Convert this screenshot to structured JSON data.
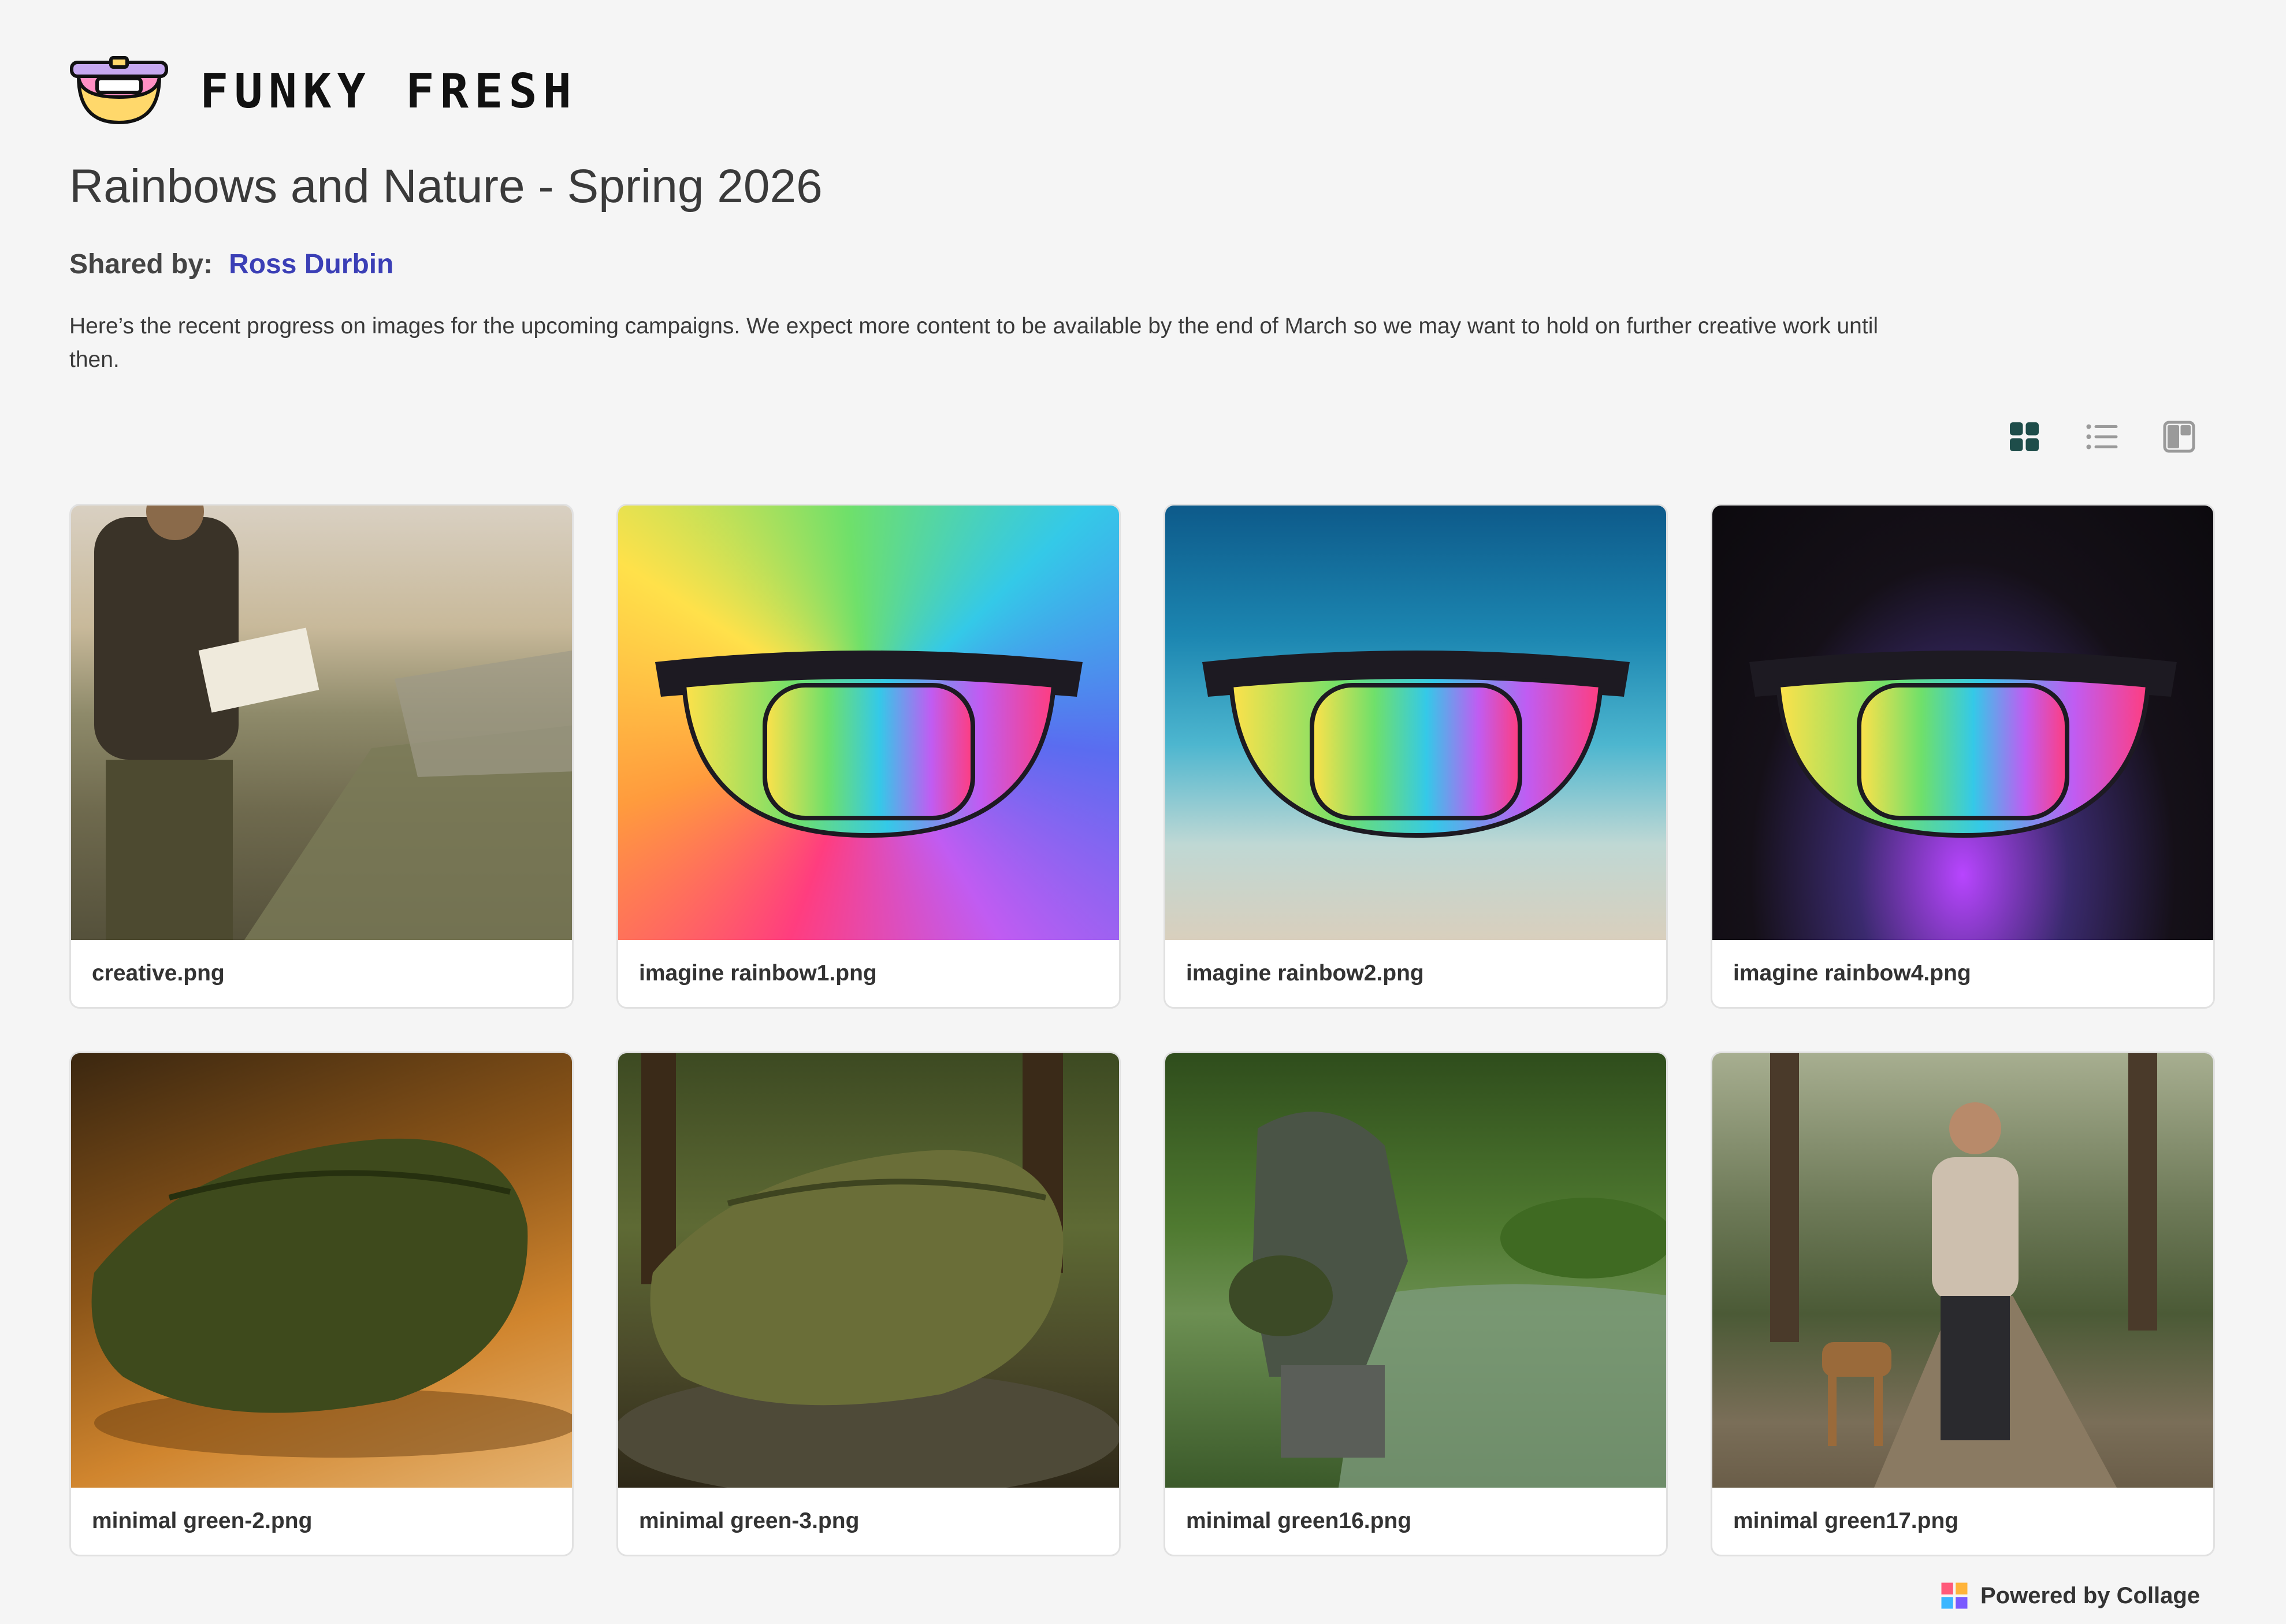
{
  "brand": {
    "name": "FUNKY FRESH",
    "logo_icon": "fanny-pack-logo-icon"
  },
  "page_title": "Rainbows and Nature - Spring 2026",
  "shared_by": {
    "label": "Shared by:",
    "name": "Ross Durbin"
  },
  "description": "Here’s the recent progress on images for the upcoming campaigns. We expect more content to be available by the end of March so we may want to hold on further creative work until then.",
  "view_modes": [
    {
      "icon": "grid-view-icon",
      "active": true
    },
    {
      "icon": "list-view-icon",
      "active": false
    },
    {
      "icon": "mosaic-view-icon",
      "active": false
    }
  ],
  "images": [
    {
      "filename": "creative.png",
      "depicts": "hiker reading a map on a mountain trail"
    },
    {
      "filename": "imagine rainbow1.png",
      "depicts": "rainbow fanny pack on rainbow glitter background"
    },
    {
      "filename": "imagine rainbow2.png",
      "depicts": "rainbow fanny pack underwater"
    },
    {
      "filename": "imagine rainbow4.png",
      "depicts": "rainbow fanny pack on dark glitter background"
    },
    {
      "filename": "minimal green-2.png",
      "depicts": "green fanny pack in warm light"
    },
    {
      "filename": "minimal green-3.png",
      "depicts": "green fanny pack on a forest rock"
    },
    {
      "filename": "minimal green16.png",
      "depicts": "photographer crouching by a forest stream"
    },
    {
      "filename": "minimal green17.png",
      "depicts": "woman walking a dog on a forest path"
    }
  ],
  "footer": {
    "text": "Powered by Collage",
    "logo_icon": "collage-logo-icon"
  },
  "colors": {
    "accent_link": "#3b3fb6",
    "active_view": "#1e4d4a",
    "inactive_view": "#9a9a9a",
    "background": "#f5f5f5"
  }
}
